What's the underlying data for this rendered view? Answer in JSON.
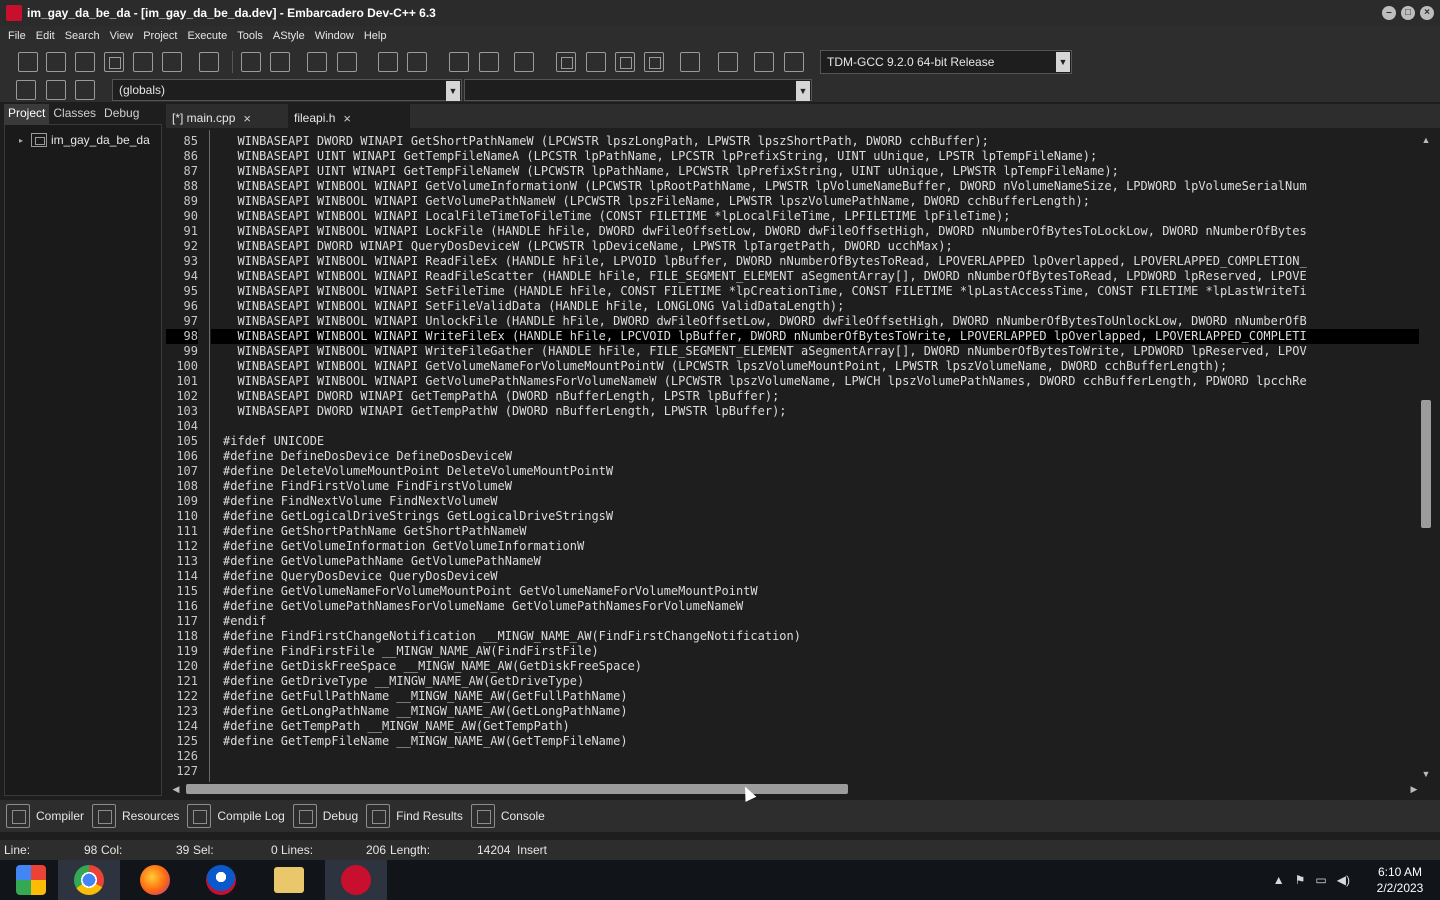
{
  "window": {
    "title": "im_gay_da_be_da - [im_gay_da_be_da.dev] - Embarcadero Dev-C++ 6.3"
  },
  "menu": [
    "File",
    "Edit",
    "Search",
    "View",
    "Project",
    "Execute",
    "Tools",
    "AStyle",
    "Window",
    "Help"
  ],
  "toolbar": {
    "compiler": "TDM-GCC 9.2.0 64-bit Release",
    "scope": "(globals)"
  },
  "left_panel": {
    "tabs": [
      "Project",
      "Classes",
      "Debug"
    ],
    "project_name": "im_gay_da_be_da"
  },
  "editor": {
    "tabs": [
      {
        "label": "[*] main.cpp",
        "close": "×"
      },
      {
        "label": "fileapi.h",
        "close": "×"
      }
    ],
    "lines": [
      {
        "n": "85",
        "code": "  WINBASEAPI DWORD WINAPI GetShortPathNameW (LPCWSTR lpszLongPath, LPWSTR lpszShortPath, DWORD cchBuffer);"
      },
      {
        "n": "86",
        "code": "  WINBASEAPI UINT WINAPI GetTempFileNameA (LPCSTR lpPathName, LPCSTR lpPrefixString, UINT uUnique, LPSTR lpTempFileName);"
      },
      {
        "n": "87",
        "code": "  WINBASEAPI UINT WINAPI GetTempFileNameW (LPCWSTR lpPathName, LPCWSTR lpPrefixString, UINT uUnique, LPWSTR lpTempFileName);"
      },
      {
        "n": "88",
        "code": "  WINBASEAPI WINBOOL WINAPI GetVolumeInformationW (LPCWSTR lpRootPathName, LPWSTR lpVolumeNameBuffer, DWORD nVolumeNameSize, LPDWORD lpVolumeSerialNum"
      },
      {
        "n": "89",
        "code": "  WINBASEAPI WINBOOL WINAPI GetVolumePathNameW (LPCWSTR lpszFileName, LPWSTR lpszVolumePathName, DWORD cchBufferLength);"
      },
      {
        "n": "90",
        "code": "  WINBASEAPI WINBOOL WINAPI LocalFileTimeToFileTime (CONST FILETIME *lpLocalFileTime, LPFILETIME lpFileTime);"
      },
      {
        "n": "91",
        "code": "  WINBASEAPI WINBOOL WINAPI LockFile (HANDLE hFile, DWORD dwFileOffsetLow, DWORD dwFileOffsetHigh, DWORD nNumberOfBytesToLockLow, DWORD nNumberOfBytes"
      },
      {
        "n": "92",
        "code": "  WINBASEAPI DWORD WINAPI QueryDosDeviceW (LPCWSTR lpDeviceName, LPWSTR lpTargetPath, DWORD ucchMax);"
      },
      {
        "n": "93",
        "code": "  WINBASEAPI WINBOOL WINAPI ReadFileEx (HANDLE hFile, LPVOID lpBuffer, DWORD nNumberOfBytesToRead, LPOVERLAPPED lpOverlapped, LPOVERLAPPED_COMPLETION_"
      },
      {
        "n": "94",
        "code": "  WINBASEAPI WINBOOL WINAPI ReadFileScatter (HANDLE hFile, FILE_SEGMENT_ELEMENT aSegmentArray[], DWORD nNumberOfBytesToRead, LPDWORD lpReserved, LPOVE"
      },
      {
        "n": "95",
        "code": "  WINBASEAPI WINBOOL WINAPI SetFileTime (HANDLE hFile, CONST FILETIME *lpCreationTime, CONST FILETIME *lpLastAccessTime, CONST FILETIME *lpLastWriteTi"
      },
      {
        "n": "96",
        "code": "  WINBASEAPI WINBOOL WINAPI SetFileValidData (HANDLE hFile, LONGLONG ValidDataLength);"
      },
      {
        "n": "97",
        "code": "  WINBASEAPI WINBOOL WINAPI UnlockFile (HANDLE hFile, DWORD dwFileOffsetLow, DWORD dwFileOffsetHigh, DWORD nNumberOfBytesToUnlockLow, DWORD nNumberOfB"
      },
      {
        "n": "98",
        "code": "  WINBASEAPI WINBOOL WINAPI WriteFileEx (HANDLE hFile, LPCVOID lpBuffer, DWORD nNumberOfBytesToWrite, LPOVERLAPPED lpOverlapped, LPOVERLAPPED_COMPLETI",
        "hl": true
      },
      {
        "n": "99",
        "code": "  WINBASEAPI WINBOOL WINAPI WriteFileGather (HANDLE hFile, FILE_SEGMENT_ELEMENT aSegmentArray[], DWORD nNumberOfBytesToWrite, LPDWORD lpReserved, LPOV"
      },
      {
        "n": "100",
        "code": "  WINBASEAPI WINBOOL WINAPI GetVolumeNameForVolumeMountPointW (LPCWSTR lpszVolumeMountPoint, LPWSTR lpszVolumeName, DWORD cchBufferLength);"
      },
      {
        "n": "101",
        "code": "  WINBASEAPI WINBOOL WINAPI GetVolumePathNamesForVolumeNameW (LPCWSTR lpszVolumeName, LPWCH lpszVolumePathNames, DWORD cchBufferLength, PDWORD lpcchRe"
      },
      {
        "n": "102",
        "code": "  WINBASEAPI DWORD WINAPI GetTempPathA (DWORD nBufferLength, LPSTR lpBuffer);"
      },
      {
        "n": "103",
        "code": "  WINBASEAPI DWORD WINAPI GetTempPathW (DWORD nBufferLength, LPWSTR lpBuffer);"
      },
      {
        "n": "104",
        "code": ""
      },
      {
        "n": "105",
        "code": "#ifdef UNICODE"
      },
      {
        "n": "106",
        "code": "#define DefineDosDevice DefineDosDeviceW"
      },
      {
        "n": "107",
        "code": "#define DeleteVolumeMountPoint DeleteVolumeMountPointW"
      },
      {
        "n": "108",
        "code": "#define FindFirstVolume FindFirstVolumeW"
      },
      {
        "n": "109",
        "code": "#define FindNextVolume FindNextVolumeW"
      },
      {
        "n": "110",
        "code": "#define GetLogicalDriveStrings GetLogicalDriveStringsW"
      },
      {
        "n": "111",
        "code": "#define GetShortPathName GetShortPathNameW"
      },
      {
        "n": "112",
        "code": "#define GetVolumeInformation GetVolumeInformationW"
      },
      {
        "n": "113",
        "code": "#define GetVolumePathName GetVolumePathNameW"
      },
      {
        "n": "114",
        "code": "#define QueryDosDevice QueryDosDeviceW"
      },
      {
        "n": "115",
        "code": "#define GetVolumeNameForVolumeMountPoint GetVolumeNameForVolumeMountPointW"
      },
      {
        "n": "116",
        "code": "#define GetVolumePathNamesForVolumeName GetVolumePathNamesForVolumeNameW"
      },
      {
        "n": "117",
        "code": "#endif"
      },
      {
        "n": "118",
        "code": "#define FindFirstChangeNotification __MINGW_NAME_AW(FindFirstChangeNotification)"
      },
      {
        "n": "119",
        "code": "#define FindFirstFile __MINGW_NAME_AW(FindFirstFile)"
      },
      {
        "n": "120",
        "code": "#define GetDiskFreeSpace __MINGW_NAME_AW(GetDiskFreeSpace)"
      },
      {
        "n": "121",
        "code": "#define GetDriveType __MINGW_NAME_AW(GetDriveType)"
      },
      {
        "n": "122",
        "code": "#define GetFullPathName __MINGW_NAME_AW(GetFullPathName)"
      },
      {
        "n": "123",
        "code": "#define GetLongPathName __MINGW_NAME_AW(GetLongPathName)"
      },
      {
        "n": "124",
        "code": "#define GetTempPath __MINGW_NAME_AW(GetTempPath)"
      },
      {
        "n": "125",
        "code": "#define GetTempFileName __MINGW_NAME_AW(GetTempFileName)"
      },
      {
        "n": "126",
        "code": ""
      },
      {
        "n": "127",
        "code": ""
      }
    ]
  },
  "bottom_tabs": [
    "Compiler",
    "Resources",
    "Compile Log",
    "Debug",
    "Find Results",
    "Console"
  ],
  "status": {
    "line_label": "Line:",
    "line": "98",
    "col_label": "Col:",
    "col": "39",
    "sel_label": "Sel:",
    "sel": "0",
    "lines_label": "Lines:",
    "lines": "206",
    "length_label": "Length:",
    "length": "14204",
    "mode": "Insert"
  },
  "taskbar": {
    "time": "6:10 AM",
    "date": "2/2/2023",
    "apps": [
      "windows-explorer-app",
      "chrome",
      "firefox",
      "edge",
      "file-explorer",
      "dev-cpp"
    ]
  },
  "colors": {
    "background": "#1e1e1e",
    "chrome": "#2d2d2d",
    "accent_devcpp": "#c8102e"
  }
}
